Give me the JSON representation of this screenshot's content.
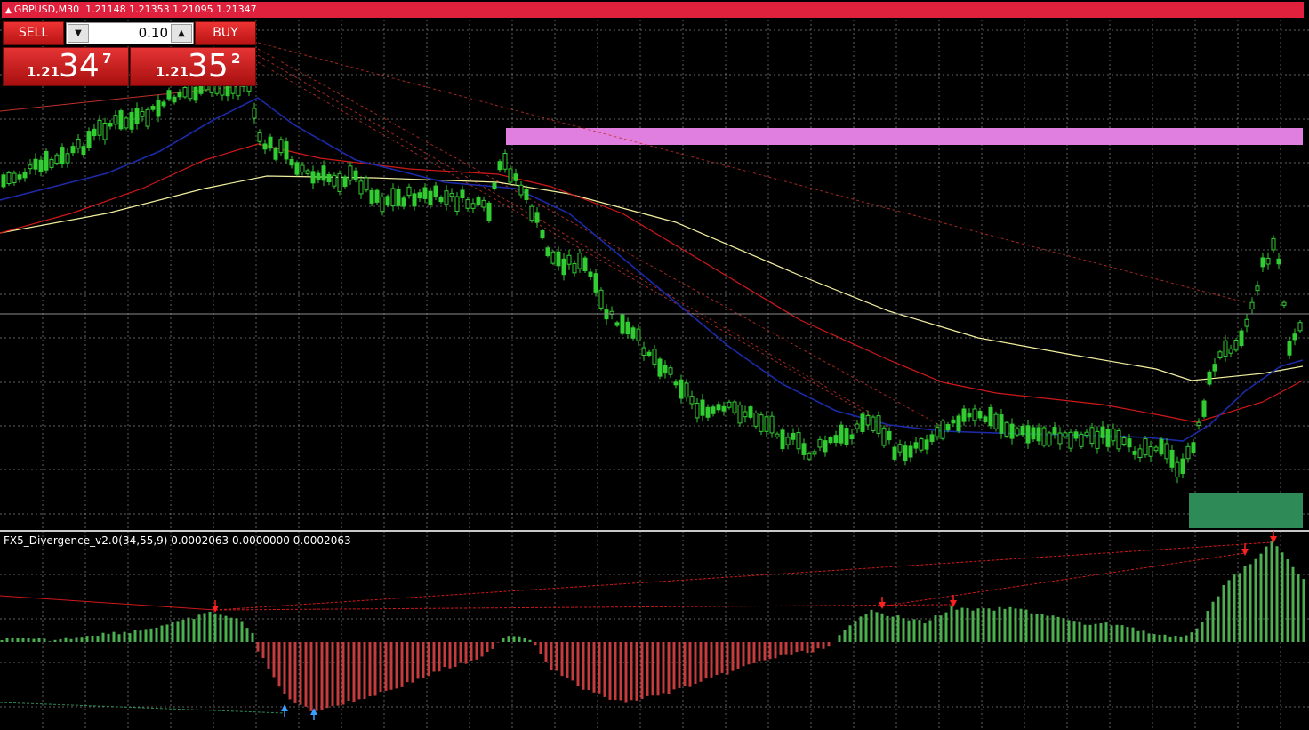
{
  "header": {
    "symbol_tf": "GBPUSD,M30",
    "ohlc": "1.21148 1.21353 1.21095 1.21347"
  },
  "trade_panel": {
    "sell_label": "SELL",
    "buy_label": "BUY",
    "lot_size": "0.10",
    "sell_price": {
      "prefix": "1.21",
      "big": "34",
      "sup": "7"
    },
    "buy_price": {
      "prefix": "1.21",
      "big": "35",
      "sup": "2"
    }
  },
  "indicator": {
    "label": "FX5_Divergence_v2.0(34,55,9) 0.0002063 0.0000000 0.0002063"
  },
  "colors": {
    "background": "#000000",
    "grid": "#8a8a8a",
    "candle": "#32cd32",
    "ma_blue": "#1c2aa8",
    "ma_red": "#d01818",
    "ma_yellow": "#f4f0a0",
    "zone_pink": "#e07fe0",
    "zone_green": "#2e8b57",
    "hist_up": "#4caf50",
    "hist_down": "#c43c3c",
    "header_bar": "#e0213e"
  }
}
